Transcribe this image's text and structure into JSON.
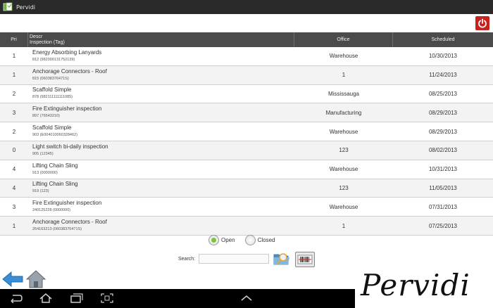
{
  "window": {
    "title": "Pervidi"
  },
  "table": {
    "headers": {
      "pri": "Pri",
      "desc_line1": "Descr",
      "desc_line2": "Inspection (Tag)",
      "office": "Office",
      "scheduled": "Scheduled"
    },
    "rows": [
      {
        "pri": "1",
        "title": "Energy Absorbing Lanyards",
        "tag": "812 (982000131752139)",
        "office": "Warehouse",
        "scheduled": "10/30/2013"
      },
      {
        "pri": "1",
        "title": "Anchorage Connectors - Roof",
        "tag": "815 (06038376471S)",
        "office": "1",
        "scheduled": "11/24/2013"
      },
      {
        "pri": "2",
        "title": "Scaffold Simple",
        "tag": "878 (982111111111085)",
        "office": "Mississauga",
        "scheduled": "08/25/2013"
      },
      {
        "pri": "3",
        "title": "Fire Extinguisher inspection",
        "tag": "897 (76543210)",
        "office": "Manufacturing",
        "scheduled": "08/29/2013"
      },
      {
        "pri": "2",
        "title": "Scaffold Simple",
        "tag": "903 (E004010060328462)",
        "office": "Warehouse",
        "scheduled": "08/29/2013"
      },
      {
        "pri": "0",
        "title": "Light switch bi-daily inspection",
        "tag": "905 (12345)",
        "office": "123",
        "scheduled": "08/02/2013"
      },
      {
        "pri": "4",
        "title": "Lifting Chain Sling",
        "tag": "913 (0000000)",
        "office": "Warehouse",
        "scheduled": "10/31/2013"
      },
      {
        "pri": "4",
        "title": "Lifting Chain Sling",
        "tag": "919 (123)",
        "office": "123",
        "scheduled": "11/05/2013"
      },
      {
        "pri": "3",
        "title": "Fire Extinguisher inspection",
        "tag": "240125228 (0000000)",
        "office": "Warehouse",
        "scheduled": "07/31/2013"
      },
      {
        "pri": "1",
        "title": "Anchorage Connectors - Roof",
        "tag": "264163213 (06038376471S)",
        "office": "1",
        "scheduled": "07/25/2013"
      }
    ]
  },
  "filter": {
    "open_label": "Open",
    "closed_label": "Closed",
    "selected": "open"
  },
  "search": {
    "label": "Search:",
    "value": "",
    "placeholder": ""
  },
  "icons": {
    "power": "power-icon",
    "folder": "folder-search-icon",
    "scan": "barcode-scan-icon",
    "back": "back-arrow-icon",
    "home": "home-icon",
    "nav_back": "nav-back-icon",
    "nav_home": "nav-home-icon",
    "nav_recent": "nav-recent-apps-icon",
    "nav_screenshot": "nav-screenshot-icon",
    "nav_up": "nav-chevron-up-icon"
  },
  "colors": {
    "header_bg": "#4b4b4b",
    "power_bg": "#c9211e",
    "radio_selected": "#7bc142"
  },
  "logo": {
    "text": "Pervidi"
  }
}
